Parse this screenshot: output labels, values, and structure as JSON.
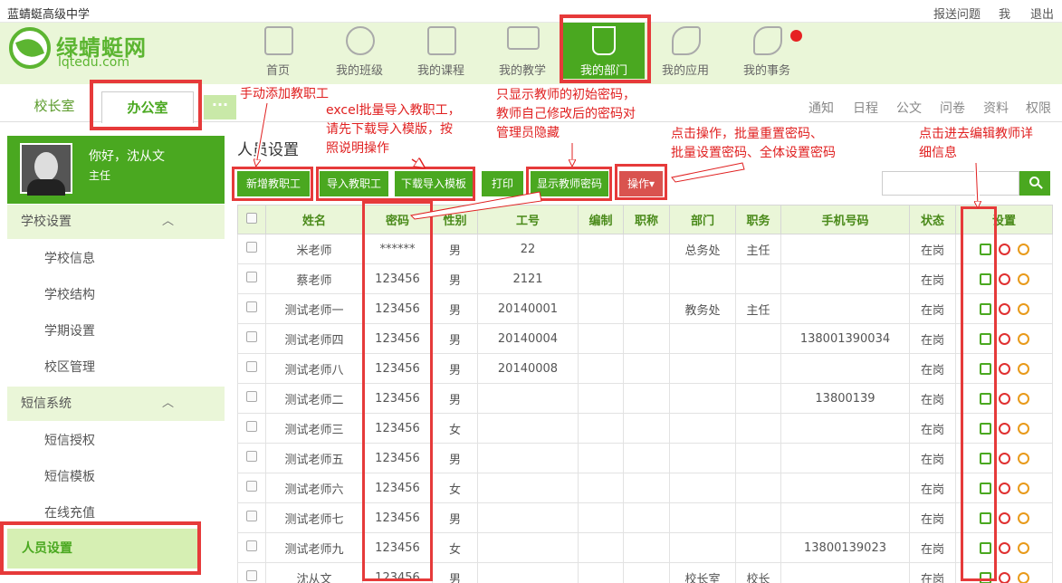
{
  "topbar": {
    "school_name": "蓝蜻蜓高级中学",
    "links": [
      "报送问题",
      "我",
      "退出"
    ]
  },
  "logo": {
    "cn": "绿蜻蜓网",
    "en": "lqtedu.com"
  },
  "nav": [
    {
      "label": "首页",
      "icon": "home-icon"
    },
    {
      "label": "我的班级",
      "icon": "users-icon"
    },
    {
      "label": "我的课程",
      "icon": "book-icon"
    },
    {
      "label": "我的教学",
      "icon": "monitor-icon"
    },
    {
      "label": "我的部门",
      "icon": "coffee-cup-icon",
      "active": true
    },
    {
      "label": "我的应用",
      "icon": "wrench-icon"
    },
    {
      "label": "我的事务",
      "icon": "phone-icon"
    }
  ],
  "subnav": {
    "tabs": [
      "校长室",
      "办公室"
    ],
    "more": "···",
    "links": [
      "通知",
      "日程",
      "公文",
      "问卷",
      "资料",
      "权限"
    ]
  },
  "user": {
    "greeting": "你好，沈从文",
    "role": "主任"
  },
  "sidebar": {
    "sections": [
      {
        "title": "学校设置",
        "items": [
          "学校信息",
          "学校结构",
          "学期设置",
          "校区管理"
        ]
      },
      {
        "title": "短信系统",
        "items": [
          "短信授权",
          "短信模板",
          "在线充值"
        ]
      }
    ],
    "active_item": "人员设置"
  },
  "main": {
    "title": "人员设置",
    "buttons": {
      "add": "新增教职工",
      "import": "导入教职工",
      "download": "下载导入模板",
      "print": "打印",
      "show_pw": "显示教师密码",
      "ops": "操作▾"
    }
  },
  "table": {
    "columns": [
      "",
      "姓名",
      "密码",
      "性别",
      "工号",
      "编制",
      "职称",
      "部门",
      "职务",
      "手机号码",
      "状态",
      "设置"
    ],
    "rows": [
      [
        "米老师",
        "******",
        "男",
        "22",
        "",
        "",
        "总务处",
        "主任",
        "",
        "在岗"
      ],
      [
        "蔡老师",
        "123456",
        "男",
        "2121",
        "",
        "",
        "",
        "",
        "",
        "在岗"
      ],
      [
        "测试老师一",
        "123456",
        "男",
        "20140001",
        "",
        "",
        "教务处",
        "主任",
        "",
        "在岗"
      ],
      [
        "测试老师四",
        "123456",
        "男",
        "20140004",
        "",
        "",
        "",
        "",
        "138001390034",
        "在岗"
      ],
      [
        "测试老师八",
        "123456",
        "男",
        "20140008",
        "",
        "",
        "",
        "",
        "",
        "在岗"
      ],
      [
        "测试老师二",
        "123456",
        "男",
        "",
        "",
        "",
        "",
        "",
        "13800139",
        "在岗"
      ],
      [
        "测试老师三",
        "123456",
        "女",
        "",
        "",
        "",
        "",
        "",
        "",
        "在岗"
      ],
      [
        "测试老师五",
        "123456",
        "男",
        "",
        "",
        "",
        "",
        "",
        "",
        "在岗"
      ],
      [
        "测试老师六",
        "123456",
        "女",
        "",
        "",
        "",
        "",
        "",
        "",
        "在岗"
      ],
      [
        "测试老师七",
        "123456",
        "男",
        "",
        "",
        "",
        "",
        "",
        "",
        "在岗"
      ],
      [
        "测试老师九",
        "123456",
        "女",
        "",
        "",
        "",
        "",
        "",
        "13800139023",
        "在岗"
      ],
      [
        "沈从文",
        "123456",
        "男",
        "",
        "",
        "",
        "校长室",
        "校长",
        "",
        "在岗"
      ]
    ]
  },
  "annotations": {
    "add": "手动添加教职工",
    "import": [
      "excel批量导入教职工，",
      "请先下载导入模版，按",
      "照说明操作"
    ],
    "show_pw": [
      "只显示教师的初始密码，",
      "教师自己修改后的密码对",
      "管理员隐藏"
    ],
    "ops": [
      "点击操作，批量重置密码、",
      "批量设置密码、全体设置密码"
    ],
    "edit": [
      "点击进去编辑教师详",
      "细信息"
    ]
  },
  "colors": {
    "brand": "#4aa820",
    "header_bg": "#eaf6d8",
    "annotation": "#e02020",
    "ops_button": "#d9534f"
  }
}
